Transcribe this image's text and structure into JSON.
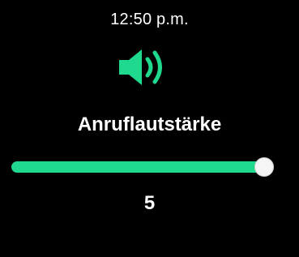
{
  "status": {
    "time": "12:50 p.m."
  },
  "icon": {
    "name": "volume-up-icon",
    "color": "#1ed98e"
  },
  "setting": {
    "title": "Anruflautstärke",
    "value": "5",
    "level_fraction": 1.0
  },
  "colors": {
    "accent": "#1ed98e",
    "background": "#000000",
    "text": "#ffffff",
    "thumb": "#f5f5f5"
  }
}
